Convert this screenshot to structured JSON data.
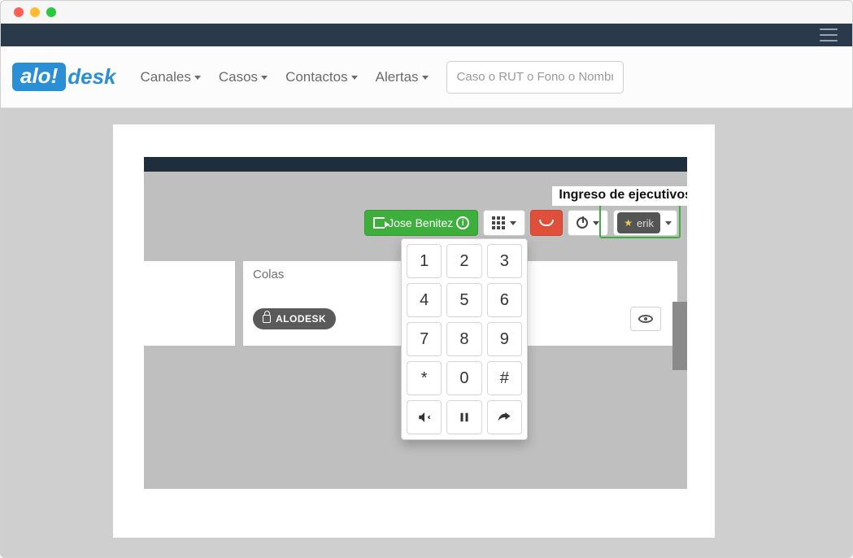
{
  "nav": {
    "items": [
      "Canales",
      "Casos",
      "Contactos",
      "Alertas"
    ],
    "search_placeholder": "Caso o RUT o Fono o Nombr"
  },
  "logo": {
    "pill": "alo!",
    "rest": "desk"
  },
  "callout": "Ingreso de ejecutivos",
  "status": {
    "agent_name": "Jose Benitez",
    "user_short": "erik"
  },
  "queues": {
    "label": "Colas",
    "badge": "ALODESK"
  },
  "dialpad": {
    "keys": [
      "1",
      "2",
      "3",
      "4",
      "5",
      "6",
      "7",
      "8",
      "9",
      "*",
      "0",
      "#"
    ],
    "actions": [
      "mute",
      "pause",
      "transfer"
    ]
  }
}
